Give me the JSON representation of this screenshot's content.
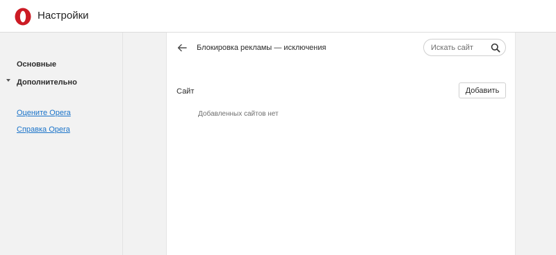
{
  "header": {
    "title": "Настройки",
    "logo_icon": "opera-logo-icon",
    "accent_color": "#cc1b24"
  },
  "sidebar": {
    "items": [
      {
        "label": "Основные"
      },
      {
        "label": "Дополнительно",
        "expanded": true
      }
    ],
    "links": [
      {
        "label": "Оцените Opera"
      },
      {
        "label": "Справка Opera"
      }
    ],
    "link_color": "#1a73c9"
  },
  "main": {
    "back_icon": "arrow-left-icon",
    "title": "Блокировка рекламы — исключения",
    "search": {
      "placeholder": "Искать сайт",
      "value": "",
      "icon": "search-icon"
    },
    "section_label": "Сайт",
    "add_button_label": "Добавить",
    "empty_message": "Добавленных сайтов нет"
  }
}
